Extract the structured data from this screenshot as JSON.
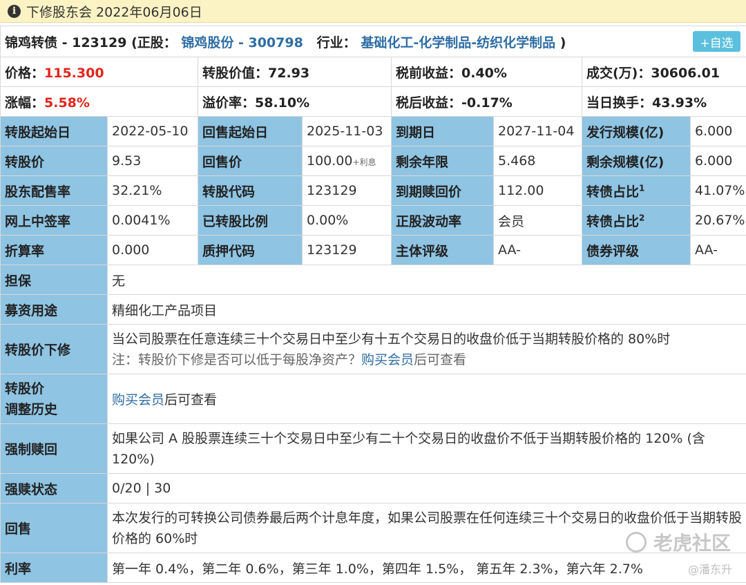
{
  "notice": {
    "text": "下修股东会 2022年06月06日"
  },
  "header": {
    "bond_name": "锦鸡转债 - 123129",
    "stock_prefix": "(正股：",
    "stock_name": "锦鸡股份 - 300798",
    "industry_prefix": "行业：",
    "industry": "基础化工-化学制品-纺织化学制品",
    "close_paren": ")",
    "add_button": "+自选"
  },
  "quote": {
    "price_label": "价格：",
    "price": "115.300",
    "conv_value": "转股价值：72.93",
    "pretax_yield": "税前收益：0.40%",
    "volume": "成交(万)：30606.01",
    "change_label": "涨幅：",
    "change": "5.58%",
    "premium": "溢价率：58.10%",
    "aftertax_yield": "税后收益：-0.17%",
    "turnover": "当日换手：43.93%"
  },
  "grid": {
    "r1": [
      "转股起始日",
      "2022-05-10",
      "回售起始日",
      "2025-11-03",
      "到期日",
      "2027-11-04",
      "发行规模(亿)",
      "6.000"
    ],
    "r2": [
      "转股价",
      "9.53",
      "回售价",
      "100.00",
      "+利息",
      "剩余年限",
      "5.468",
      "剩余规模(亿)",
      "6.000"
    ],
    "r3": [
      "股东配售率",
      "32.21%",
      "转股代码",
      "123129",
      "到期赎回价",
      "112.00",
      "转债占比",
      "1",
      "41.07%"
    ],
    "r4": [
      "网上中签率",
      "0.0041%",
      "已转股比例",
      "0.00%",
      "正股波动率",
      "会员",
      "转债占比",
      "2",
      "20.67%"
    ],
    "r5": [
      "折算率",
      "0.000",
      "质押代码",
      "123129",
      "主体评级",
      "AA-",
      "债券评级",
      "AA-"
    ]
  },
  "details": {
    "guarantee_label": "担保",
    "guarantee": "无",
    "use_label": "募资用途",
    "use": "精细化工产品项目",
    "reset_label": "转股价下修",
    "reset_line1": "当公司股票在任意连续三十个交易日中至少有十五个交易日的收盘价低于当期转股价格的 80%时",
    "reset_note_prefix": "注：转股价下修是否可以低于每股净资产？",
    "reset_note_link": "购买会员",
    "reset_note_suffix": "后可查看",
    "history_label_1": "转股价",
    "history_label_2": "调整历史",
    "history_link": "购买会员",
    "history_suffix": "后可查看",
    "redeem_label": "强制赎回",
    "redeem": "如果公司 A 股股票连续三十个交易日中至少有二十个交易日的收盘价不低于当期转股价格的 120% (含 120%)",
    "redeem_status_label": "强赎状态",
    "redeem_status": "0/20 | 30",
    "putback_label": "回售",
    "putback": "本次发行的可转换公司债券最后两个计息年度，如果公司股票在任何连续三十个交易日的收盘价低于当期转股价格的 60%时",
    "rate_label": "利率",
    "rate": "第一年 0.4%，第二年 0.6%，第三年 1.0%，第四年 1.5%， 第五年 2.3%，第六年 2.7%"
  },
  "watermark": {
    "brand": "老虎社区",
    "author": "@潘东升"
  }
}
